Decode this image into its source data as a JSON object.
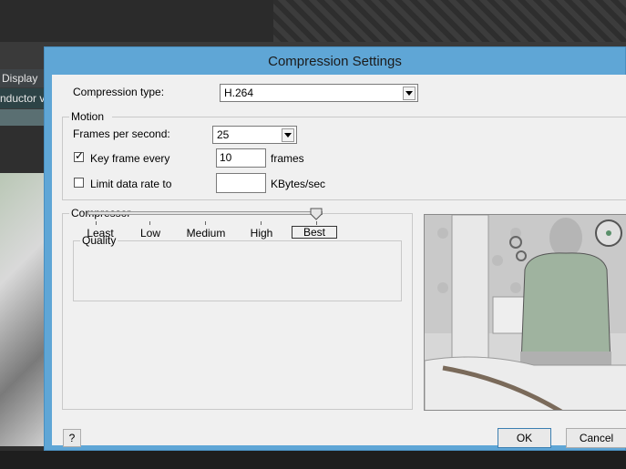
{
  "background_app": {
    "menu_item": "Display",
    "panel_item": "nductor v"
  },
  "dialog": {
    "title": "Compression Settings",
    "compression_type": {
      "label": "Compression type:",
      "value": "H.264"
    },
    "motion": {
      "group_label": "Motion",
      "fps": {
        "label": "Frames per second:",
        "value": "25"
      },
      "key_frame": {
        "label": "Key frame every",
        "checked": true,
        "check_glyph": "✓",
        "value": "10",
        "unit": "frames"
      },
      "limit_rate": {
        "label": "Limit data rate to",
        "checked": false,
        "value": "",
        "unit": "KBytes/sec"
      }
    },
    "compressor": {
      "group_label": "Compressor",
      "quality": {
        "label": "Quality",
        "ticks": [
          "Least",
          "Low",
          "Medium",
          "High",
          "Best"
        ],
        "selected": "Best",
        "level_fraction": 1.0
      }
    },
    "buttons": {
      "help": "?",
      "ok": "OK",
      "cancel": "Cancel"
    }
  },
  "colors": {
    "title_bar": "#5fa6d6",
    "client": "#f0f0f0",
    "default_button_border": "#3c7fb1"
  }
}
